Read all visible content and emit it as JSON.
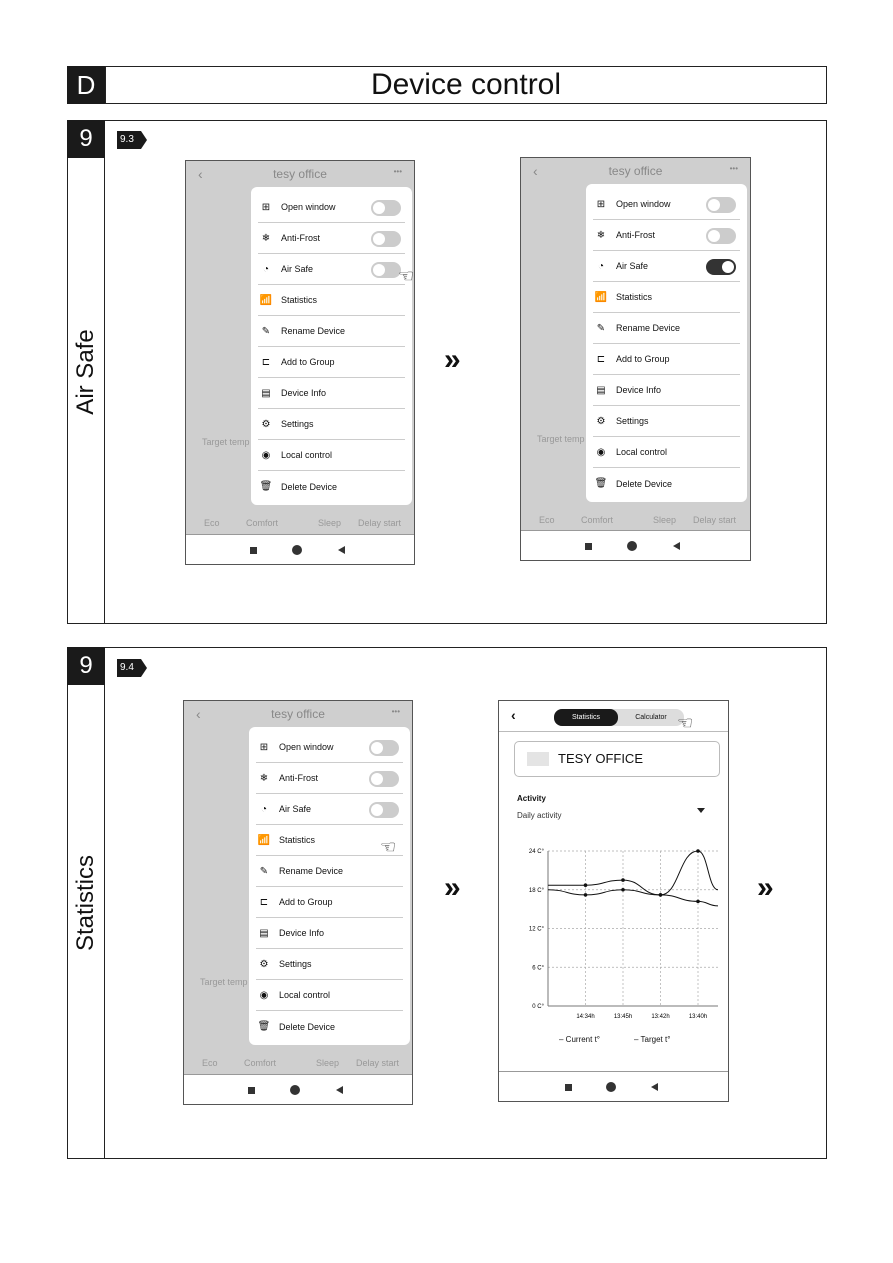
{
  "header": {
    "letter": "D",
    "title": "Device control"
  },
  "sections": [
    {
      "number": "9",
      "side_label": "Air Safe",
      "step": "9.3"
    },
    {
      "number": "9",
      "side_label": "Statistics",
      "step": "9.4"
    }
  ],
  "next_arrow": "»",
  "app": {
    "title": "tesy office",
    "back": "‹",
    "more": "•••",
    "background_labels": {
      "target": "Target temp",
      "modes": [
        "Eco",
        "Comfort",
        "Sleep",
        "Delay start"
      ]
    },
    "menu_items": [
      {
        "label": "Open window",
        "icon": "window-icon",
        "glyph": "⊞",
        "toggle": true
      },
      {
        "label": "Anti-Frost",
        "icon": "snowflake-icon",
        "glyph": "❄",
        "toggle": true
      },
      {
        "label": "Air Safe",
        "icon": "air-safe-icon",
        "glyph": "◔",
        "toggle": true
      },
      {
        "label": "Statistics",
        "icon": "statistics-icon",
        "glyph": "📶"
      },
      {
        "label": "Rename Device",
        "icon": "pencil-icon",
        "glyph": "✎"
      },
      {
        "label": "Add to Group",
        "icon": "add-folder-icon",
        "glyph": "⊏"
      },
      {
        "label": "Device Info",
        "icon": "document-icon",
        "glyph": "▤"
      },
      {
        "label": "Settings",
        "icon": "gear-icon",
        "glyph": "⚙"
      },
      {
        "label": "Local control",
        "icon": "location-pin-icon",
        "glyph": "◉"
      },
      {
        "label": "Delete Device",
        "icon": "trash-icon",
        "glyph": "🗑"
      }
    ]
  },
  "screens": [
    {
      "air_safe_on": false,
      "pointer_on": "Air Safe"
    },
    {
      "air_safe_on": true
    },
    {
      "air_safe_on": false,
      "pointer_on": "Statistics"
    }
  ],
  "stats_screen": {
    "tabs": [
      "Statistics",
      "Calculator"
    ],
    "active_tab": "Statistics",
    "device_name": "TESY OFFICE",
    "activity_label": "Activity",
    "period": "Daily activity",
    "chart": {
      "type": "line",
      "categories": [
        "14:34h",
        "13:45h",
        "13:42h",
        "13:40h"
      ],
      "yticks": [
        "0 C°",
        "6 C°",
        "12 C°",
        "18 C°",
        "24 C°"
      ],
      "ylim": [
        0,
        24
      ],
      "grid": true,
      "legend_placement": "bottom",
      "series": [
        {
          "name": "Current t°",
          "values": [
            17.2,
            18,
            17.2,
            16.2
          ]
        },
        {
          "name": "Target t°",
          "values": [
            18.7,
            19.5,
            17.2,
            24
          ]
        }
      ]
    }
  }
}
